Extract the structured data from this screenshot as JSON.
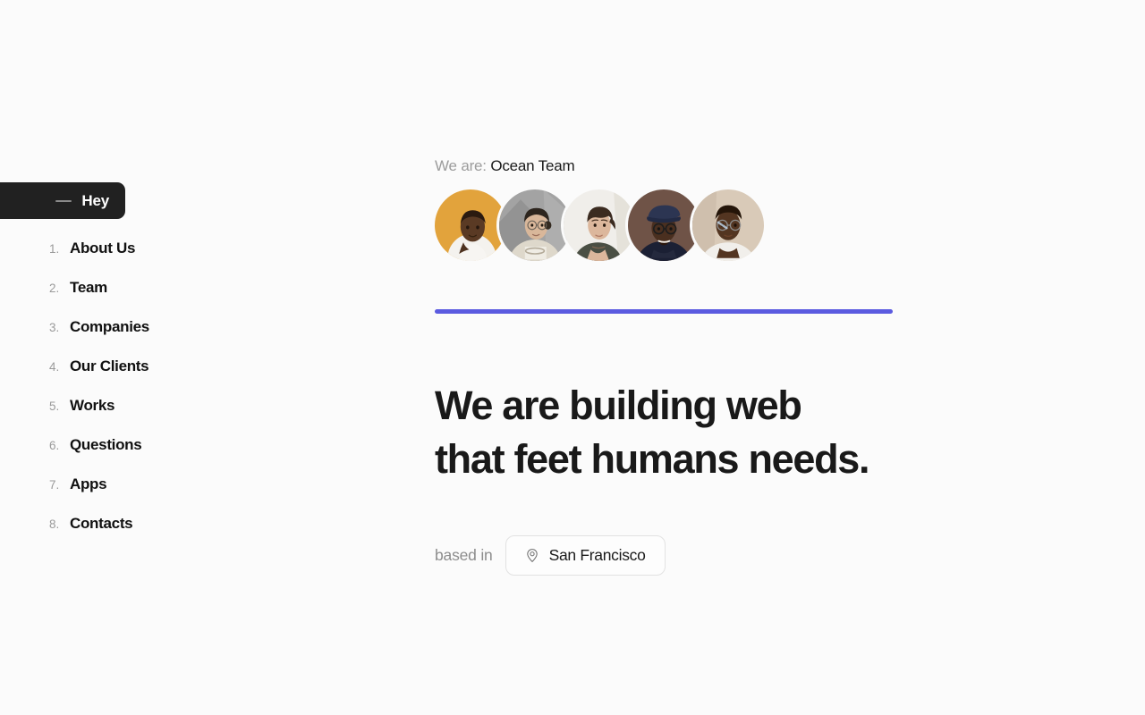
{
  "page": {
    "background_color": "#fbfbfb",
    "accent_color": "#5b5be0"
  },
  "sidebar": {
    "active_tab": {
      "label": "Hey",
      "icon": "dash-icon",
      "background_color": "#212121",
      "text_color": "#ffffff"
    },
    "items": [
      {
        "number": "1.",
        "label": "About Us"
      },
      {
        "number": "2.",
        "label": "Team"
      },
      {
        "number": "3.",
        "label": "Companies"
      },
      {
        "number": "4.",
        "label": "Our Clients"
      },
      {
        "number": "5.",
        "label": "Works"
      },
      {
        "number": "6.",
        "label": "Questions"
      },
      {
        "number": "7.",
        "label": "Apps"
      },
      {
        "number": "8.",
        "label": "Contacts"
      }
    ]
  },
  "main": {
    "team": {
      "prefix": "We are:",
      "name": "Ocean Team"
    },
    "avatars": [
      {
        "name": "team-member-1",
        "background_color": "#e2a33c",
        "skin": "#5a3a24",
        "clothing": "#f4f2ee"
      },
      {
        "name": "team-member-2",
        "background_color": "#a3a3a3",
        "skin": "#d9b79a",
        "clothing": "#ded8cb"
      },
      {
        "name": "team-member-3",
        "background_color": "#f0eeea",
        "skin": "#dcb79c",
        "clothing": "#4a4f44"
      },
      {
        "name": "team-member-4",
        "background_color": "#6f5347",
        "skin": "#4a2f1f",
        "clothing": "#1b2034"
      },
      {
        "name": "team-member-5",
        "background_color": "#d9cab8",
        "skin": "#533521",
        "clothing": "#f1efeb"
      }
    ],
    "headline": {
      "line1": "We are building web",
      "line2": "that feet humans needs."
    },
    "location": {
      "label": "based in",
      "icon": "map-pin-icon",
      "value": "San Francisco"
    }
  }
}
